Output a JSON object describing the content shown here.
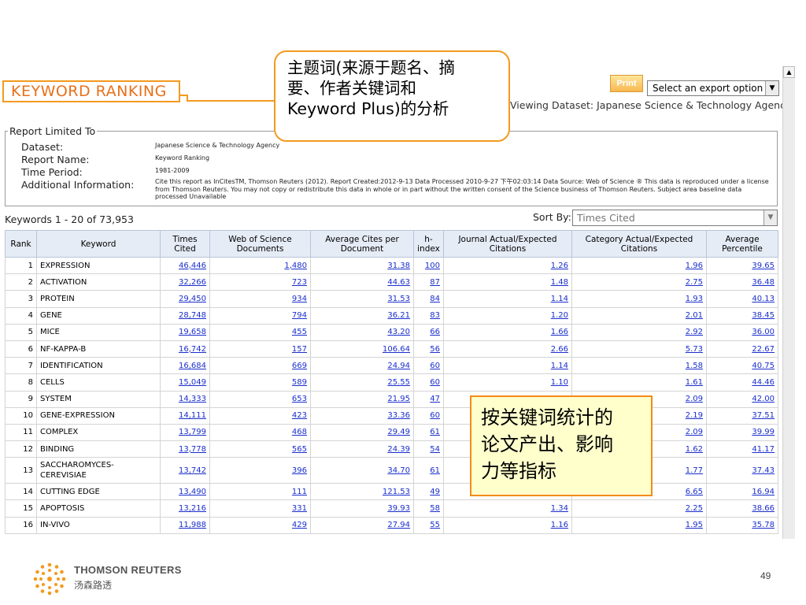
{
  "heading": "KEYWORD RANKING",
  "callout_top": [
    "主题词(来源于题名、摘",
    "要、作者关键词和",
    "Keyword Plus)的分析"
  ],
  "callout_bottom": [
    "按关键词统计的",
    "论文产出、影响",
    "力等指标"
  ],
  "toolbar": {
    "print_label": "Print",
    "export_selected": "Select an export option"
  },
  "viewing_dataset": "Viewing Dataset: Japanese Science & Technology Agency",
  "report": {
    "legend": "Report Limited To",
    "dataset_label": "Dataset:",
    "dataset_value": "Japanese Science & Technology Agency",
    "name_label": "Report Name:",
    "name_value": "Keyword Ranking",
    "period_label": "Time Period:",
    "period_value": "1981-2009",
    "info_label": "Additional Information:",
    "info_value": "Cite this report as InCitesTM, Thomson Reuters (2012). Report Created:2012-9-13  Data Processed 2010-9-27 下午02:03:14  Data Source: Web of Science ® This data is reproduced under a license from Thomson Reuters. You may not copy or redistribute this data in whole or in part without the written consent of the Science business of Thomson Reuters. Subject area baseline data processed Unavailable"
  },
  "keyword_count": "Keywords  1 - 20  of  73,953",
  "sort": {
    "label": "Sort By:",
    "selected": "Times Cited"
  },
  "table": {
    "headers": [
      "Rank",
      "Keyword",
      "Times Cited",
      "Web of Science Documents",
      "Average Cites per Document",
      "h-index",
      "Journal Actual/Expected Citations",
      "Category Actual/Expected Citations",
      "Average Percentile"
    ],
    "rows": [
      [
        "1",
        "EXPRESSION",
        "46,446",
        "1,480",
        "31.38",
        "100",
        "1.26",
        "1.96",
        "39.65"
      ],
      [
        "2",
        "ACTIVATION",
        "32,266",
        "723",
        "44.63",
        "87",
        "1.48",
        "2.75",
        "36.48"
      ],
      [
        "3",
        "PROTEIN",
        "29,450",
        "934",
        "31.53",
        "84",
        "1.14",
        "1.93",
        "40.13"
      ],
      [
        "4",
        "GENE",
        "28,748",
        "794",
        "36.21",
        "83",
        "1.20",
        "2.01",
        "38.45"
      ],
      [
        "5",
        "MICE",
        "19,658",
        "455",
        "43.20",
        "66",
        "1.66",
        "2.92",
        "36.00"
      ],
      [
        "6",
        "NF-KAPPA-B",
        "16,742",
        "157",
        "106.64",
        "56",
        "2.66",
        "5.73",
        "22.67"
      ],
      [
        "7",
        "IDENTIFICATION",
        "16,684",
        "669",
        "24.94",
        "60",
        "1.14",
        "1.58",
        "40.75"
      ],
      [
        "8",
        "CELLS",
        "15,049",
        "589",
        "25.55",
        "60",
        "1.10",
        "1.61",
        "44.46"
      ],
      [
        "9",
        "SYSTEM",
        "14,333",
        "653",
        "21.95",
        "47",
        "",
        "2.09",
        "42.00"
      ],
      [
        "10",
        "GENE-EXPRESSION",
        "14,111",
        "423",
        "33.36",
        "60",
        "",
        "2.19",
        "37.51"
      ],
      [
        "11",
        "COMPLEX",
        "13,799",
        "468",
        "29.49",
        "61",
        "",
        "2.09",
        "39.99"
      ],
      [
        "12",
        "BINDING",
        "13,778",
        "565",
        "24.39",
        "54",
        "",
        "1.62",
        "41.17"
      ],
      [
        "13",
        "SACCHAROMYCES-CEREVISIAE",
        "13,742",
        "396",
        "34.70",
        "61",
        "",
        "1.77",
        "37.43"
      ],
      [
        "14",
        "CUTTING EDGE",
        "13,490",
        "111",
        "121.53",
        "49",
        "",
        "6.65",
        "16.94"
      ],
      [
        "15",
        "APOPTOSIS",
        "13,216",
        "331",
        "39.93",
        "58",
        "1.34",
        "2.25",
        "38.66"
      ],
      [
        "16",
        "IN-VIVO",
        "11,988",
        "429",
        "27.94",
        "55",
        "1.16",
        "1.95",
        "35.78"
      ]
    ]
  },
  "footer": {
    "brand": "THOMSON REUTERS",
    "brand_cn": "汤森路透",
    "page": "49"
  }
}
